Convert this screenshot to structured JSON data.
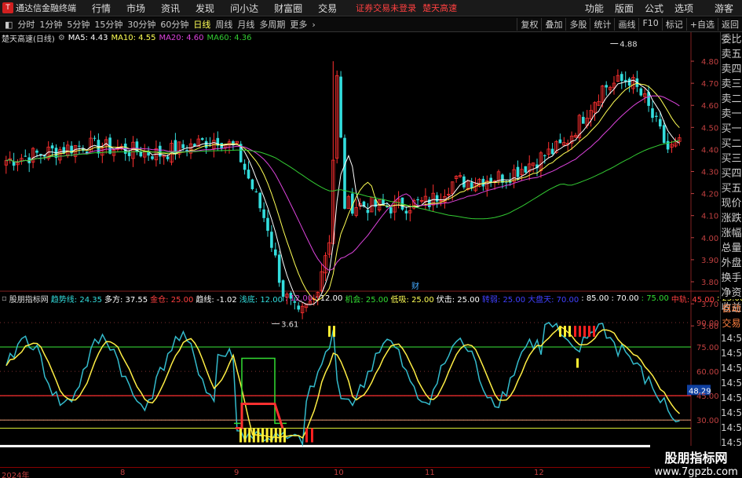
{
  "menubar": {
    "app_title": "通达信金融终端",
    "items": [
      "行情",
      "市场",
      "资讯",
      "发现",
      "问小达",
      "财富圈",
      "交易"
    ],
    "status": "证券交易未登录",
    "stock": "楚天高速",
    "right_items": [
      "功能",
      "版面",
      "公式",
      "选项",
      "游客"
    ]
  },
  "toolbar": {
    "periods": [
      "分时",
      "1分钟",
      "5分钟",
      "15分钟",
      "30分钟",
      "60分钟",
      "日线",
      "周线",
      "月线",
      "多周期",
      "更多"
    ],
    "active_period": "日线",
    "buttons": [
      "复权",
      "叠加",
      "多股",
      "统计",
      "画线",
      "F10",
      "标记",
      "+自选",
      "返回"
    ]
  },
  "info": {
    "name": "楚天高速(日线)",
    "ma5": "MA5: 4.43",
    "ma10": "MA10: 4.55",
    "ma20": "MA20: 4.60",
    "ma60": "MA60: 4.36"
  },
  "price_axis": [
    "4.80",
    "4.70",
    "4.60",
    "4.50",
    "4.40",
    "4.30",
    "4.20",
    "4.10",
    "4.00",
    "3.90",
    "3.80",
    "3.70",
    "3.60"
  ],
  "annotations": {
    "high": "4.88",
    "low": "3.61",
    "cai": "财"
  },
  "indicator": {
    "name": "股朋指标网",
    "fields": [
      {
        "label": "趋势线: 24.35",
        "color": "#33dddd"
      },
      {
        "label": "多方: 37.55",
        "color": "#ffffff"
      },
      {
        "label": "金仓: 25.00",
        "color": "#ff4040"
      },
      {
        "label": "趋线: -1.02",
        "color": "#ffffff"
      },
      {
        "label": "浅底: 12.00",
        "color": "#33dddd"
      },
      {
        "label": ": 12.00",
        "color": "#cc44cc"
      },
      {
        "label": ": 12.00",
        "color": "#ffffff"
      },
      {
        "label": "机会: 25.00",
        "color": "#33dd33"
      },
      {
        "label": "低吸: 25.00",
        "color": "#ffff55"
      },
      {
        "label": "伏击: 25.00",
        "color": "#ffffff"
      },
      {
        "label": "转弱: 25.00",
        "color": "#4040ff"
      },
      {
        "label": "大盘天: 70.00",
        "color": "#4040ff"
      },
      {
        "label": ": 85.00",
        "color": "#ffffff"
      },
      {
        "label": ": 70.00",
        "color": "#ffffff"
      },
      {
        "label": ": 75.00",
        "color": "#33dd33"
      },
      {
        "label": "中轨: 45.00",
        "color": "#ff4040"
      },
      {
        "label": ": 25.00",
        "color": "#ffff55"
      }
    ],
    "axis": [
      "90.00",
      "75.00",
      "60.00",
      "45.00",
      "30.00"
    ],
    "current": "48.29"
  },
  "side_quote": [
    "委比",
    "卖五",
    "卖四",
    "卖三",
    "卖二",
    "卖一",
    "买一",
    "买二",
    "买三",
    "买四",
    "买五",
    "现价",
    "涨跌",
    "涨幅",
    "总量",
    "外盘",
    "换手",
    "净资",
    "收益"
  ],
  "side_quote2": [
    "自动",
    "交易",
    "14:56",
    "14:56",
    "14:56",
    "14:56",
    "14:56",
    "14:56",
    "14:56",
    "14:56"
  ],
  "xaxis": [
    "2024年",
    "8",
    "9",
    "10",
    "11",
    "12"
  ],
  "watermark": {
    "line1": "股朋指标网",
    "line2": "www.7gpzb.com"
  },
  "colors": {
    "up": "#ff3030",
    "down": "#33dddd",
    "ma5": "#ffffff",
    "ma10": "#ffff55",
    "ma20": "#dd44dd",
    "ma60": "#33cc33"
  }
}
